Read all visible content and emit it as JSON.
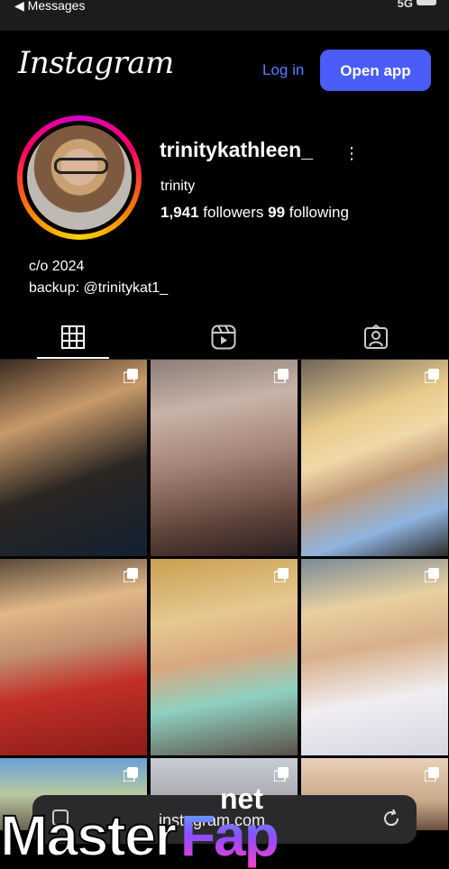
{
  "status_bar": {
    "back_label": "◀ Messages",
    "signal_text": "5G"
  },
  "header": {
    "logo": "Instagram",
    "login_label": "Log in",
    "open_app_label": "Open app"
  },
  "profile": {
    "username": "trinitykathleen_",
    "full_name": "trinity",
    "followers_count": "1,941",
    "followers_label": "followers",
    "following_count": "99",
    "following_label": "following",
    "bio_line1": "c/o 2024",
    "bio_line2": "backup: @trinitykat1_"
  },
  "tabs": [
    "posts-grid-icon",
    "reels-icon",
    "tagged-icon"
  ],
  "browser": {
    "url": "instagram.com"
  },
  "watermark": {
    "net": "net",
    "master": "Master",
    "fap": "Fap"
  },
  "colors": {
    "accent_blue": "#4a5df9",
    "link_blue": "#5b7bff",
    "background": "#000000"
  }
}
